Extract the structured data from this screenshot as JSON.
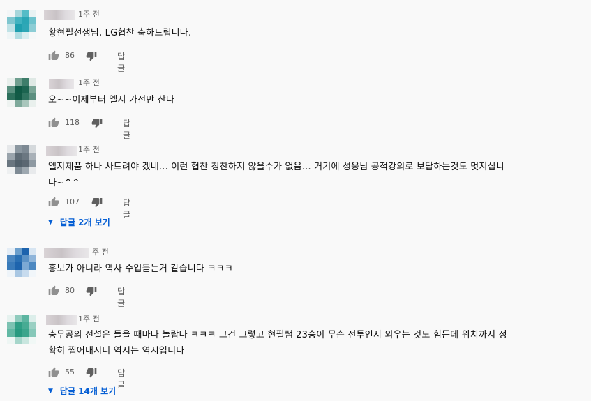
{
  "comments": [
    {
      "time": "1주 전",
      "text": "황현필선생님, LG협찬 축하드립니다.",
      "likes": "86",
      "reply_label": "답글",
      "avatar_colors": [
        "#f3f6f7",
        "#a6d6db",
        "#55bcc7",
        "#e8f2f3",
        "#7fc6cf",
        "#41b3c0",
        "#2aa6b5",
        "#6ec3cd",
        "#bfe2e6",
        "#1e9fae",
        "#2ea7b6",
        "#8ccdd5",
        "#eef5f6",
        "#b0dde2",
        "#d8eef0",
        "#f5f8f8"
      ]
    },
    {
      "time": "1주 전",
      "text": "오~~이제부터 엘지 가전만 산다",
      "likes": "118",
      "reply_label": "답글",
      "avatar_colors": [
        "#e8efec",
        "#6f9f8f",
        "#3e7d6a",
        "#dfe9e5",
        "#5a9180",
        "#0f5a45",
        "#1c6450",
        "#7aa697",
        "#2d705c",
        "#125a46",
        "#2f735f",
        "#5c8f80",
        "#eef3f1",
        "#7ea99b",
        "#a9c6bc",
        "#e9f0ed"
      ]
    },
    {
      "time": "1주 전",
      "text": "엘지제품 하나 사드려야 겠네... 이런 협찬 칭찬하지 않을수가 없음... 거기에 성웅님 공적강의로 보답하는것도 멋지십니\n다~^^",
      "likes": "107",
      "reply_label": "답글",
      "replies_label": "답글 2개 보기",
      "avatar_colors": [
        "#e6e8ea",
        "#8b97a0",
        "#7d8993",
        "#d5d9dc",
        "#9aa4ac",
        "#5e6b75",
        "#6b7781",
        "#a9b1b8",
        "#6a7680",
        "#52606b",
        "#5b6772",
        "#8e99a2",
        "#eef0f1",
        "#7f8b95",
        "#9ea8b0",
        "#e8eaec"
      ]
    },
    {
      "time": "주 전",
      "text": "홍보가 아니라 역사 수업듣는거 같습니다 ㅋㅋㅋ",
      "likes": "80",
      "reply_label": "답글",
      "avatar_colors": [
        "#e4edf6",
        "#6a9ecc",
        "#1d63ad",
        "#d7e5f2",
        "#4a86c0",
        "#2a70b4",
        "#5b92c6",
        "#8fb5da",
        "#3a7bba",
        "#1e64ad",
        "#7ca9d4",
        "#4c88c1",
        "#eef4f9",
        "#a9c7e3",
        "#c7dbee",
        "#f1f6fa"
      ]
    },
    {
      "time": "1주 전",
      "text": "충무공의 전설은 들을 때마다 놀랍다 ㅋㅋㅋ 그건 그렇고 현필쌤 23승이 무슨 전투인지 외우는 것도 힘든데 위치까지 정\n확히 찝어내시니 역시는 역시입니다",
      "likes": "55",
      "reply_label": "답글",
      "replies_label": "답글 14개 보기",
      "avatar_colors": [
        "#e6f2ef",
        "#8fcbbd",
        "#5db5a1",
        "#dceeea",
        "#7cc2b2",
        "#2f9e85",
        "#47ab93",
        "#9ad0c3",
        "#62b8a4",
        "#279a80",
        "#3aa58c",
        "#86c8b9",
        "#eef6f4",
        "#a6d6cb",
        "#c9e6df",
        "#f1f8f6"
      ]
    }
  ]
}
